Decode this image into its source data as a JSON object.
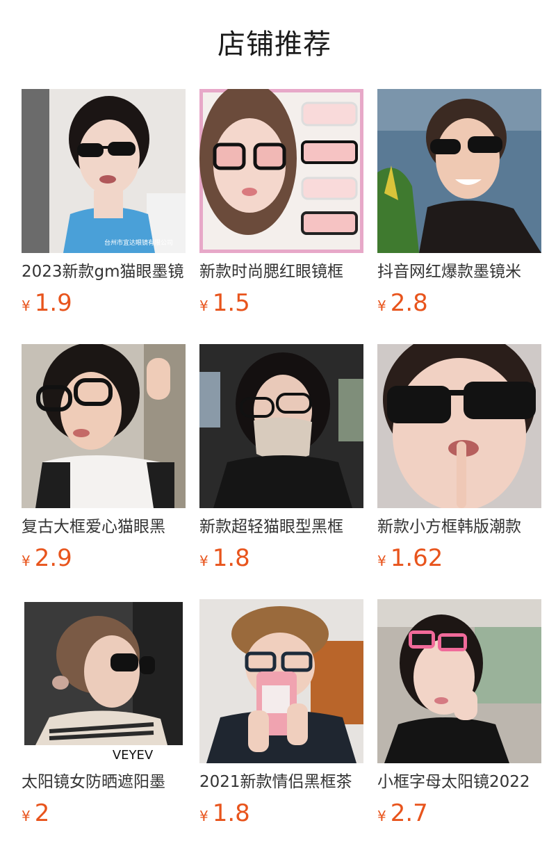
{
  "header": {
    "title": "店铺推荐"
  },
  "products": [
    {
      "title": "2023新款gm猫眼墨镜",
      "currency": "¥",
      "price": "1.9",
      "image_caption": "台州市宜达眼镜有限公司"
    },
    {
      "title": "新款时尚腮红眼镜框",
      "currency": "¥",
      "price": "1.5"
    },
    {
      "title": "抖音网红爆款墨镜米",
      "currency": "¥",
      "price": "2.8"
    },
    {
      "title": "复古大框爱心猫眼黑",
      "currency": "¥",
      "price": "2.9"
    },
    {
      "title": "新款超轻猫眼型黑框",
      "currency": "¥",
      "price": "1.8"
    },
    {
      "title": "新款小方框韩版潮款",
      "currency": "¥",
      "price": "1.62"
    },
    {
      "title": "太阳镜女防晒遮阳墨",
      "currency": "¥",
      "price": "2",
      "image_caption": "VEYEV"
    },
    {
      "title": "2021新款情侣黑框茶",
      "currency": "¥",
      "price": "1.8"
    },
    {
      "title": "小框字母太阳镜2022",
      "currency": "¥",
      "price": "2.7"
    }
  ],
  "colors": {
    "price": "#e8541c",
    "title": "#333333",
    "header": "#1a1a1a"
  }
}
